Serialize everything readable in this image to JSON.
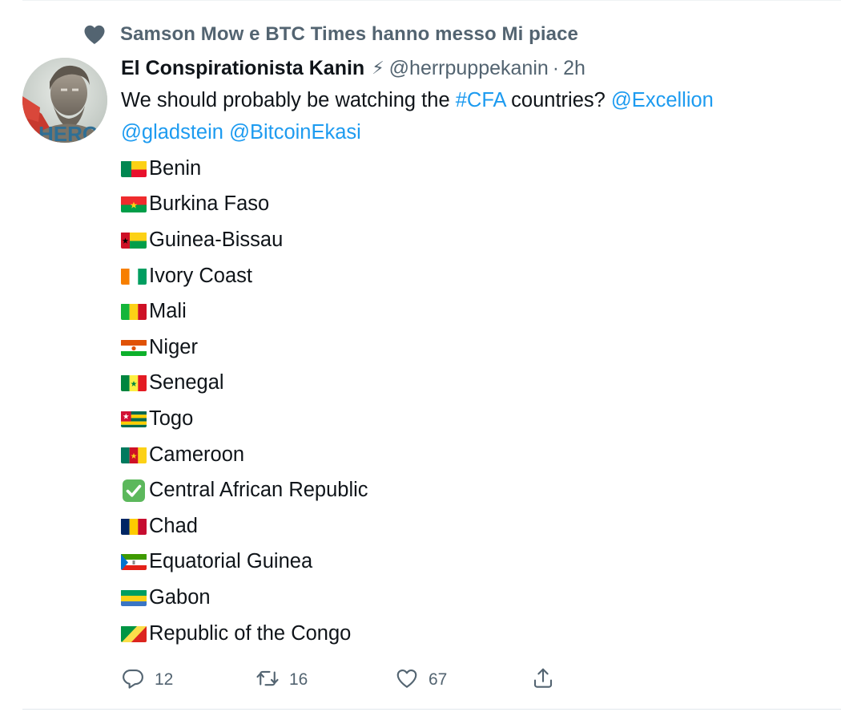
{
  "social_context": {
    "text": "Samson Mow e BTC Times hanno messo Mi piace",
    "icon": "heart-filled-icon"
  },
  "author": {
    "display_name": "El Conspirationista Kanin",
    "badge": "⚡",
    "handle": "@herrpuppekanin",
    "separator": "·",
    "time": "2h",
    "avatar_text": "HERO"
  },
  "tweet": {
    "text_1": "We should probably be watching the ",
    "hashtag": "#CFA",
    "text_2": " countries? ",
    "mention_1": "@Excellion",
    "mention_2": "@gladstein",
    "mention_3": "@BitcoinEkasi"
  },
  "countries": [
    {
      "flag": "benin-flag-icon",
      "name": "Benin"
    },
    {
      "flag": "burkina-faso-flag-icon",
      "name": "Burkina Faso"
    },
    {
      "flag": "guinea-bissau-flag-icon",
      "name": "Guinea-Bissau"
    },
    {
      "flag": "ivory-coast-flag-icon",
      "name": "Ivory Coast"
    },
    {
      "flag": "mali-flag-icon",
      "name": "Mali"
    },
    {
      "flag": "niger-flag-icon",
      "name": "Niger"
    },
    {
      "flag": "senegal-flag-icon",
      "name": "Senegal"
    },
    {
      "flag": "togo-flag-icon",
      "name": "Togo"
    },
    {
      "flag": "cameroon-flag-icon",
      "name": "Cameroon"
    },
    {
      "flag": "check-mark-icon",
      "name": "Central African Republic"
    },
    {
      "flag": "chad-flag-icon",
      "name": "Chad"
    },
    {
      "flag": "equatorial-guinea-flag-icon",
      "name": "Equatorial Guinea"
    },
    {
      "flag": "gabon-flag-icon",
      "name": "Gabon"
    },
    {
      "flag": "republic-of-the-congo-flag-icon",
      "name": "Republic of the Congo"
    }
  ],
  "actions": {
    "replies": "12",
    "retweets": "16",
    "likes": "67",
    "reply_icon": "reply-icon",
    "retweet_icon": "retweet-icon",
    "like_icon": "heart-outline-icon",
    "share_icon": "share-icon"
  },
  "colors": {
    "link": "#1d9bf0",
    "secondary_text": "#536471",
    "primary_text": "#0f1419"
  }
}
